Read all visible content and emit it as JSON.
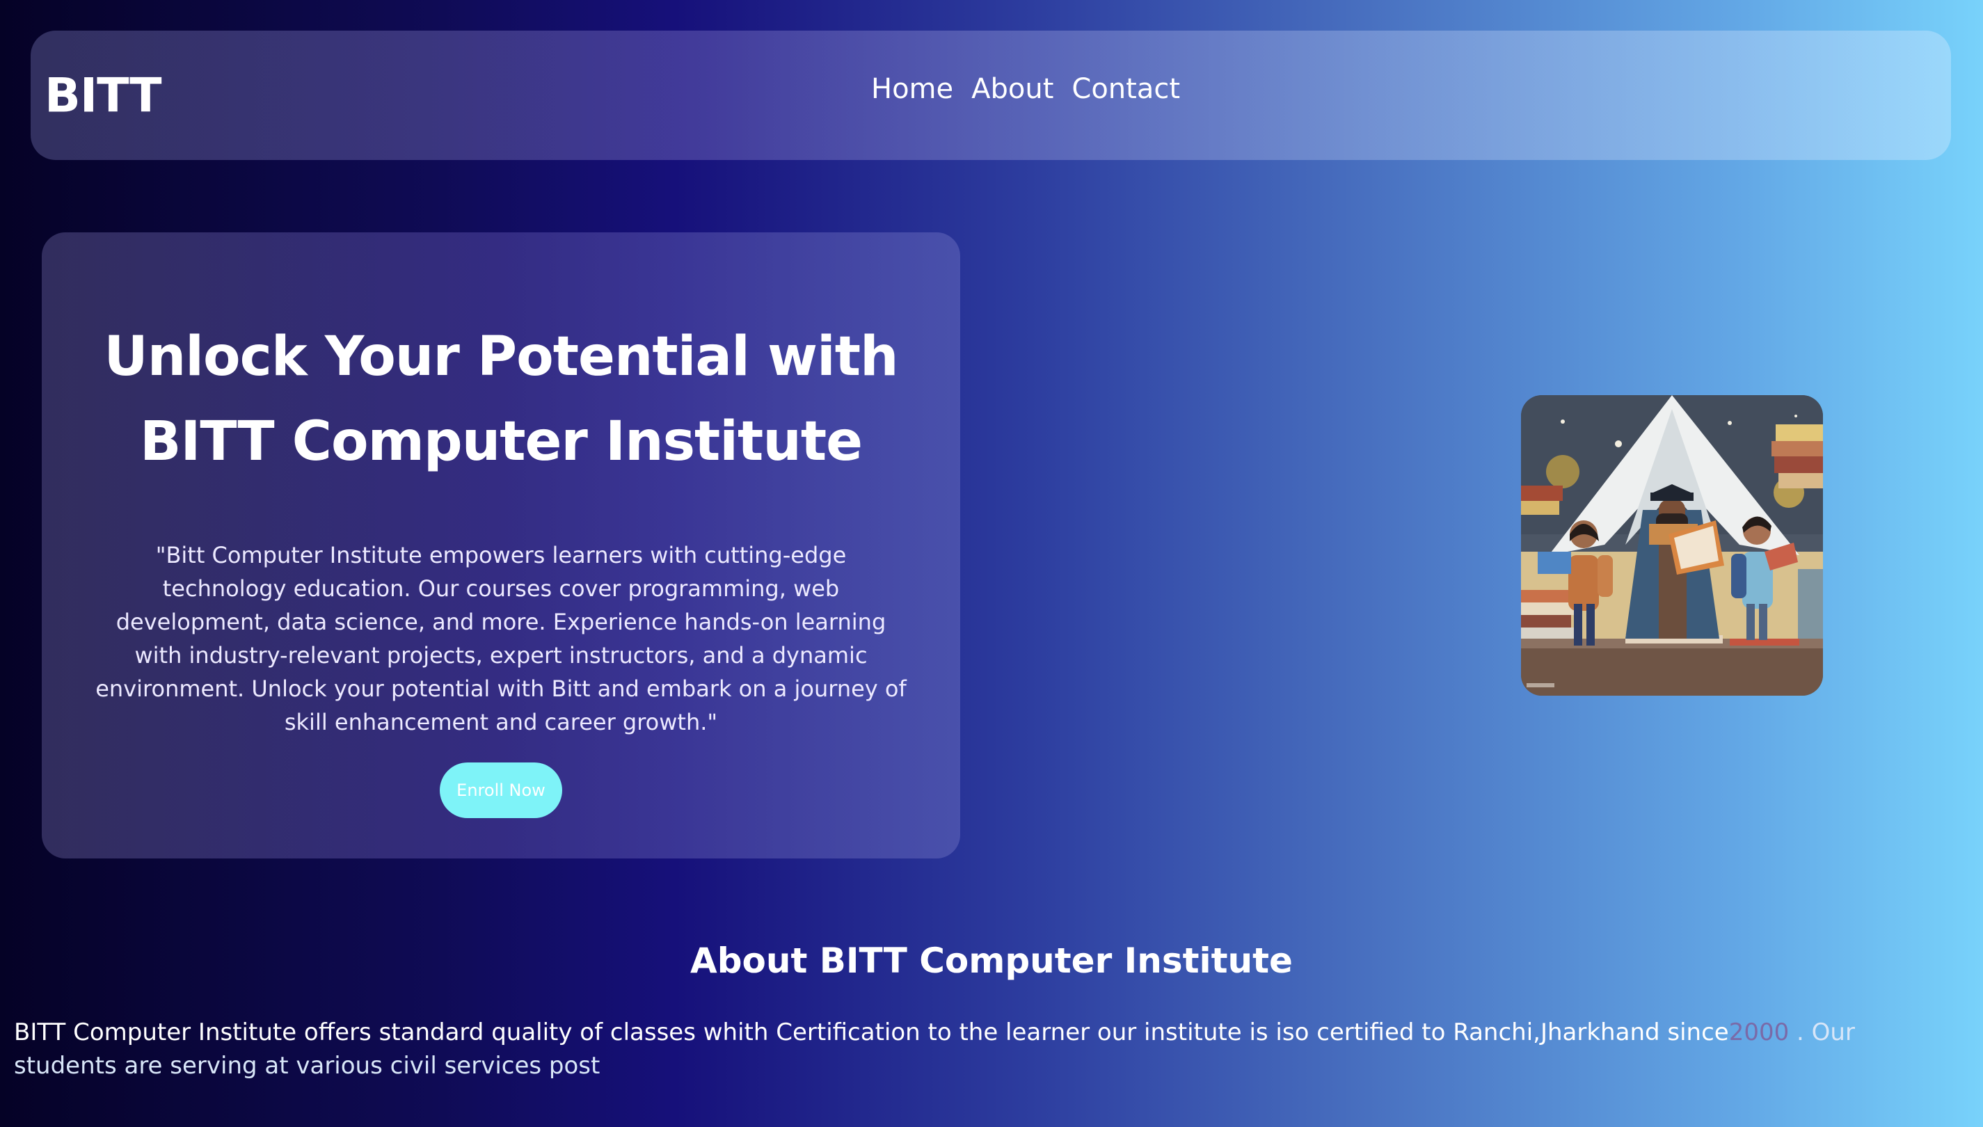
{
  "navbar": {
    "brand": "BITT",
    "links": [
      {
        "label": "Home"
      },
      {
        "label": "About"
      },
      {
        "label": "Contact"
      }
    ]
  },
  "hero": {
    "title_line1": "Unlock Your Potential with",
    "title_line2": "BITT Computer Institute",
    "description": "\"Bitt Computer Institute empowers learners with cutting-edge technology education. Our courses cover programming, web development, data science, and more. Experience hands-on learning with industry-relevant projects, expert instructors, and a dynamic environment. Unlock your potential with Bitt and embark on a journey of skill enhancement and career growth.\"",
    "enroll_label": "Enroll Now"
  },
  "about": {
    "heading": "About BITT Computer Institute",
    "text_part1": "BITT Computer Institute offers standard quality of classes whith Certification to the learner our institute is iso certified to Ranchi,Jharkhand since",
    "year": "2000",
    "text_part2": " . Our students are serving at various civil services post"
  },
  "colors": {
    "accent": "#7ef3f8",
    "year_highlight": "#7a6aa8"
  }
}
